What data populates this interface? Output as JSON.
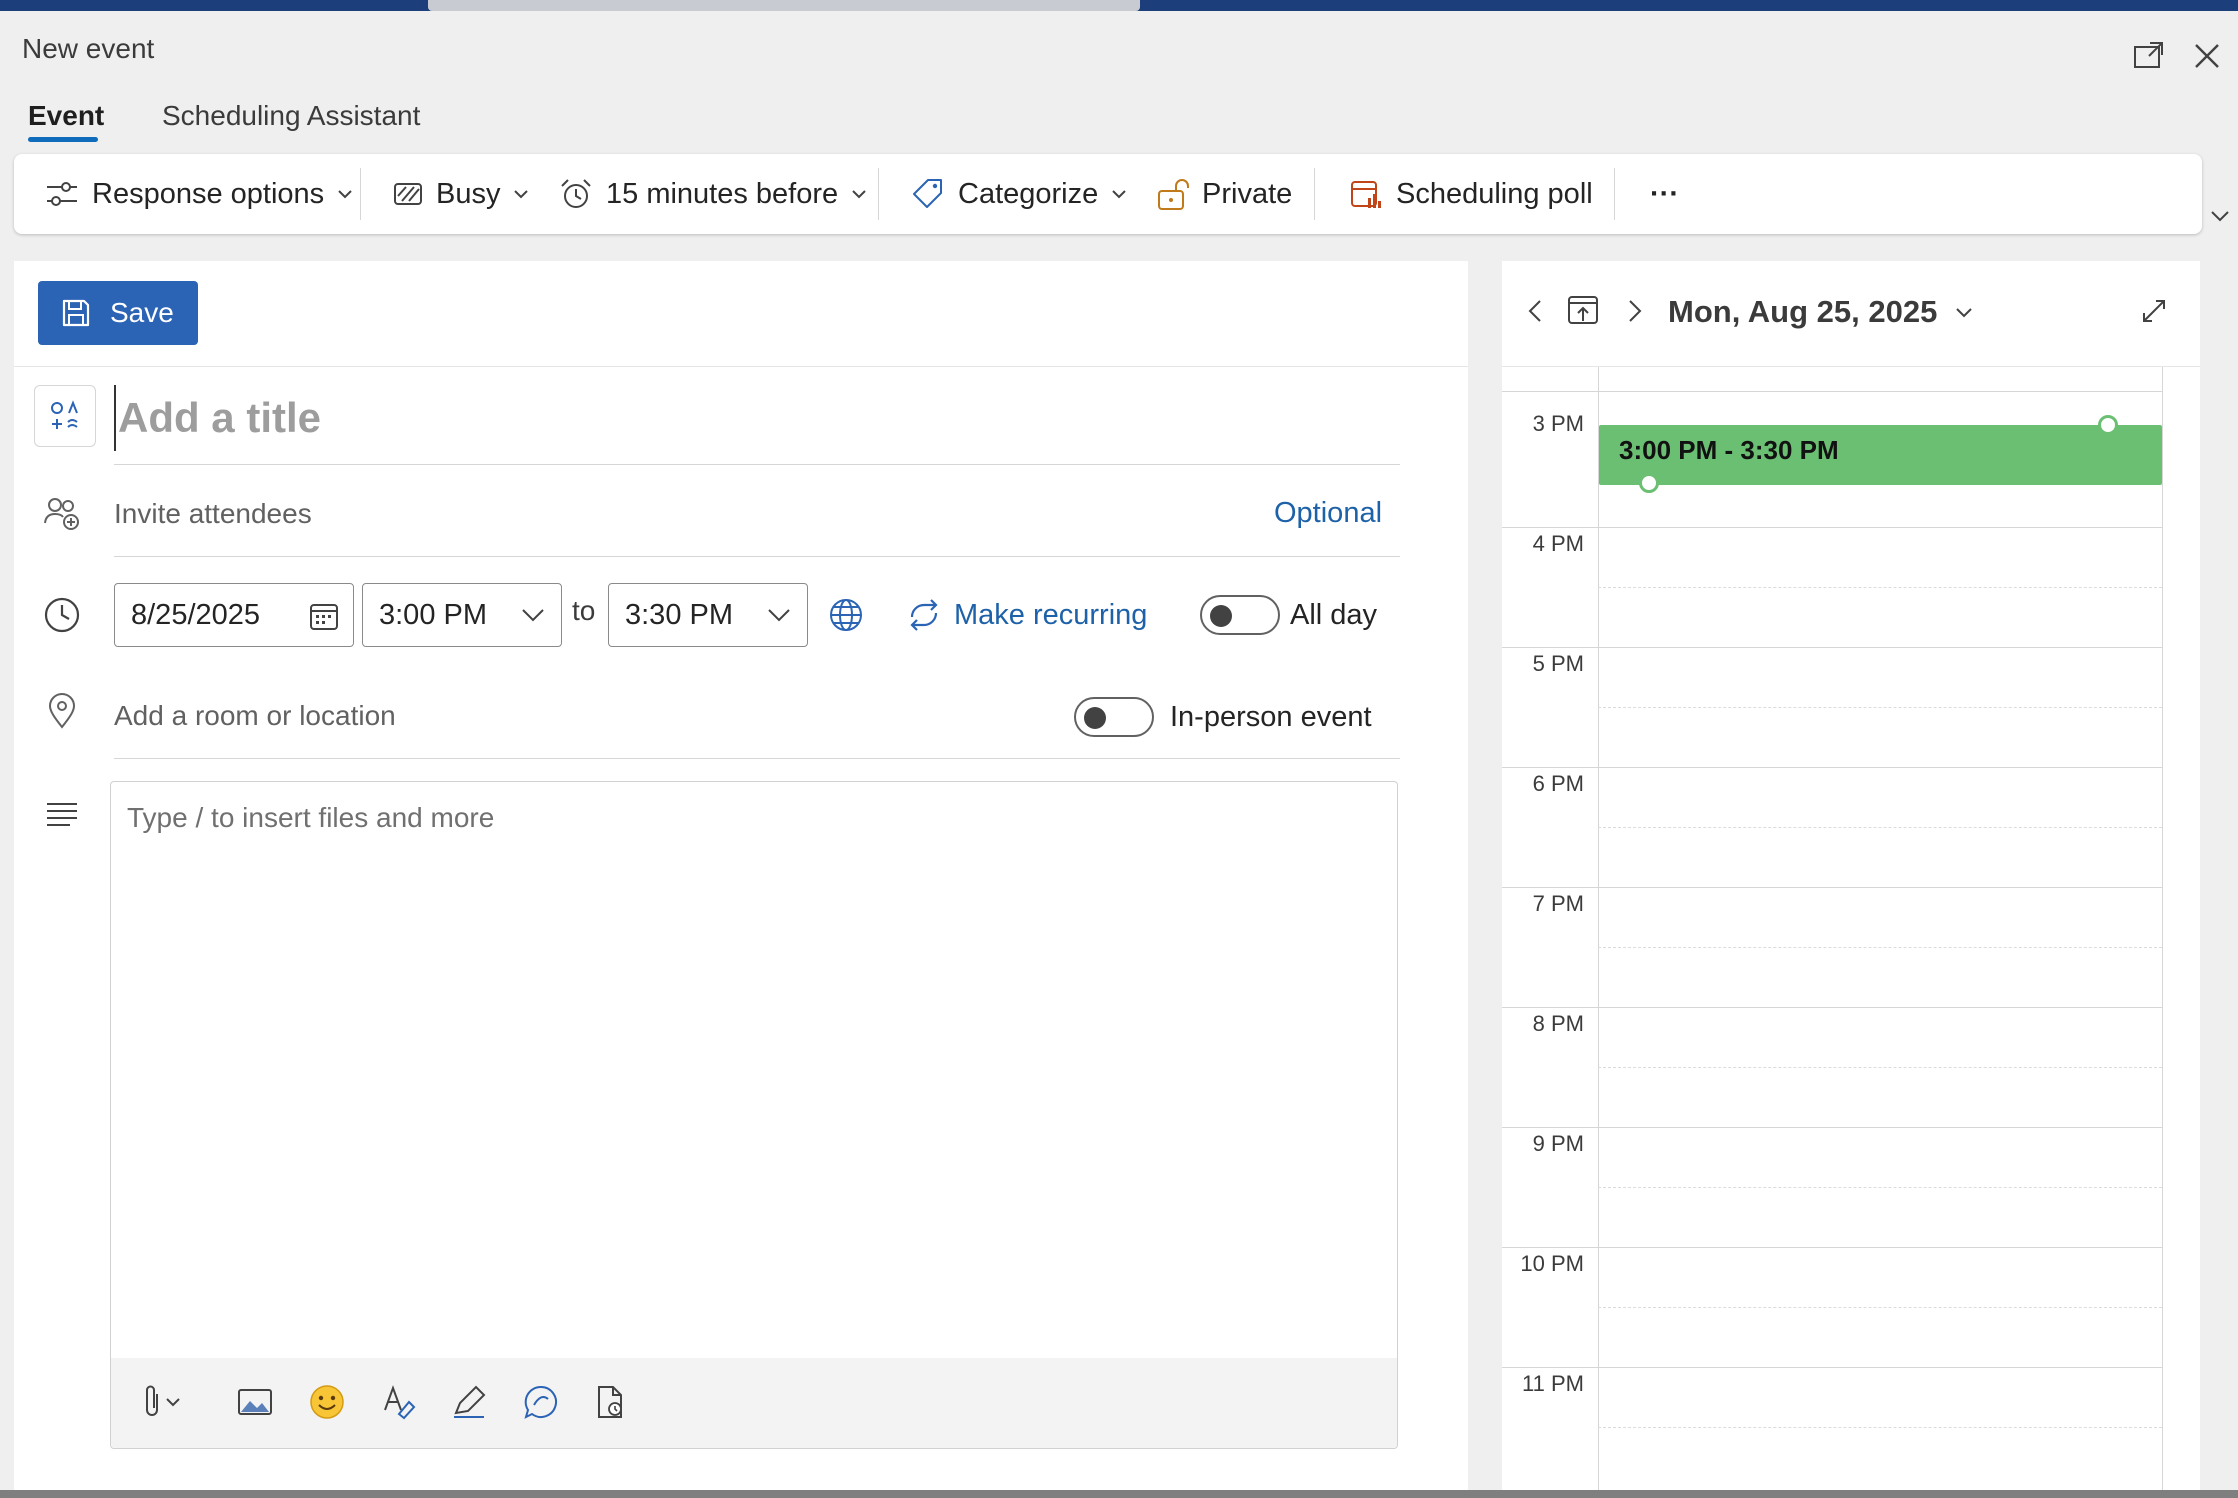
{
  "window": {
    "title": "New event"
  },
  "tabs": [
    {
      "label": "Event",
      "active": true
    },
    {
      "label": "Scheduling Assistant",
      "active": false
    }
  ],
  "ribbon": {
    "response_options": "Response options",
    "show_as": "Busy",
    "reminder": "15 minutes before",
    "categorize": "Categorize",
    "private": "Private",
    "scheduling_poll": "Scheduling poll",
    "more": "···"
  },
  "form": {
    "save_label": "Save",
    "title_placeholder": "Add a title",
    "attendees_placeholder": "Invite attendees",
    "optional_label": "Optional",
    "start_date": "8/25/2025",
    "start_time": "3:00 PM",
    "to_label": "to",
    "end_time": "3:30 PM",
    "make_recurring": "Make recurring",
    "all_day_label": "All day",
    "all_day_on": false,
    "location_placeholder": "Add a room or location",
    "in_person_label": "In-person event",
    "in_person_on": false,
    "body_placeholder": "Type / to insert files and more"
  },
  "calendar": {
    "date_label": "Mon, Aug 25, 2025",
    "hours": [
      "3 PM",
      "4 PM",
      "5 PM",
      "6 PM",
      "7 PM",
      "8 PM",
      "9 PM",
      "10 PM",
      "11 PM"
    ],
    "event_label": "3:00 PM - 3:30 PM",
    "event_color": "#6bbf73"
  },
  "colors": {
    "accent": "#2b63b5",
    "link": "#1d62a8",
    "tab_underline": "#0f6cbd"
  }
}
